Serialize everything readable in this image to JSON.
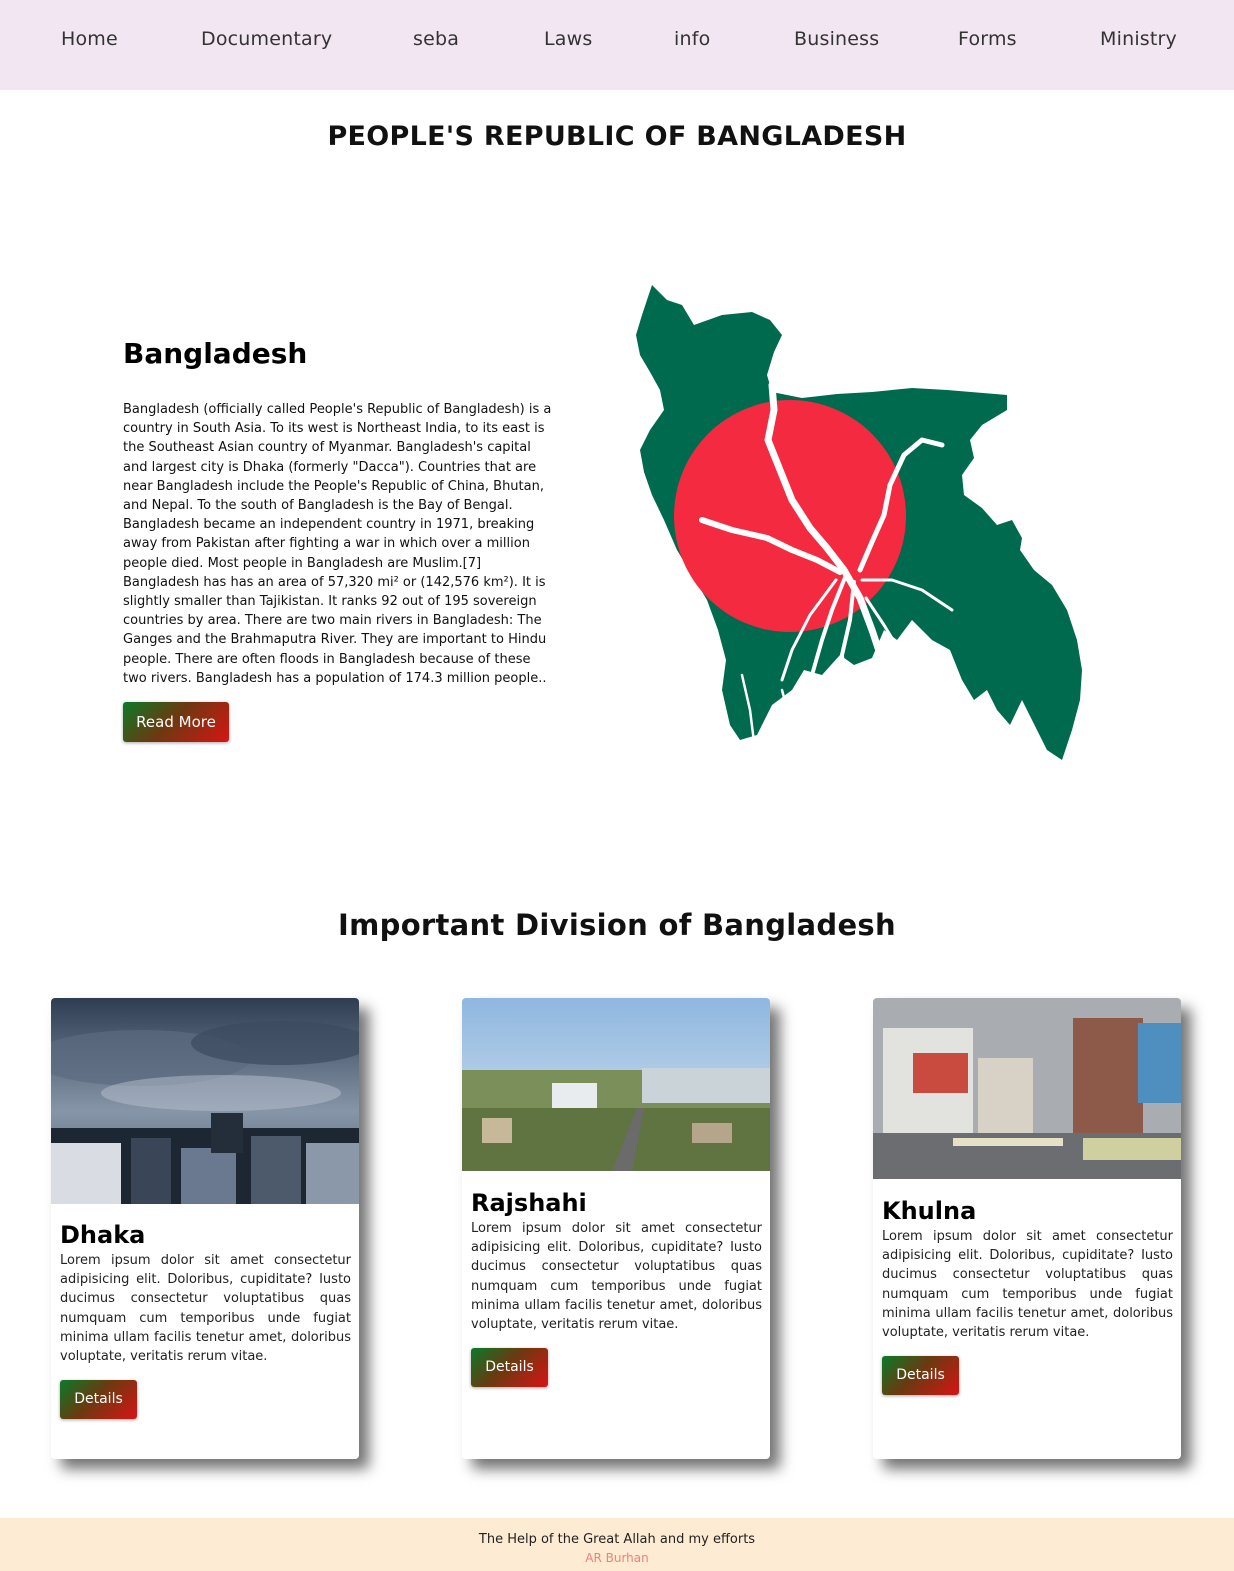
{
  "nav": {
    "items": [
      "Home",
      "Documentary",
      "seba",
      "Laws",
      "info",
      "Business",
      "Forms",
      "Ministry"
    ]
  },
  "page_title": "PEOPLE'S REPUBLIC OF BANGLADESH",
  "intro": {
    "heading": "Bangladesh",
    "text": "Bangladesh (officially called People's Republic of Bangladesh) is a country in South Asia. To its west is Northeast India, to its east is the Southeast Asian country of Myanmar. Bangladesh's capital and largest city is Dhaka (formerly \"Dacca\"). Countries that are near Bangladesh include the People's Republic of China, Bhutan, and Nepal. To the south of Bangladesh is the Bay of Bengal. Bangladesh became an independent country in 1971, breaking away from Pakistan after fighting a war in which over a million people died. Most people in Bangladesh are Muslim.[7] Bangladesh has has an area of 57,320 mi² or (142,576 km²). It is slightly smaller than Tajikistan. It ranks 92 out of 195 sovereign countries by area. There are two main rivers in Bangladesh: The Ganges and the Brahmaputra River. They are important to Hindu people. There are often floods in Bangladesh because of these two rivers. Bangladesh has a population of 174.3 million people..",
    "button_label": "Read More"
  },
  "divisions": {
    "title": "Important Division of Bangladesh",
    "cards": [
      {
        "name": "Dhaka",
        "text": "Lorem ipsum dolor sit amet consectetur adipisicing elit. Doloribus, cupiditate? Iusto ducimus consectetur voluptatibus quas numquam cum temporibus unde fugiat minima ullam facilis tenetur amet, doloribus voluptate, veritatis rerum vitae.",
        "button_label": "Details"
      },
      {
        "name": "Rajshahi",
        "text": "Lorem ipsum dolor sit amet consectetur adipisicing elit. Doloribus, cupiditate? Iusto ducimus consectetur voluptatibus quas numquam cum temporibus unde fugiat minima ullam facilis tenetur amet, doloribus voluptate, veritatis rerum vitae.",
        "button_label": "Details"
      },
      {
        "name": "Khulna",
        "text": "Lorem ipsum dolor sit amet consectetur adipisicing elit. Doloribus, cupiditate? Iusto ducimus consectetur voluptatibus quas numquam cum temporibus unde fugiat minima ullam facilis tenetur amet, doloribus voluptate, veritatis rerum vitae.",
        "button_label": "Details"
      }
    ]
  },
  "footer": {
    "line": "The Help of the Great Allah and my efforts",
    "author": "AR Burhan"
  },
  "colors": {
    "nav_bg": "#f2e6f2",
    "footer_bg": "#fdebd3",
    "flag_green": "#006a4e",
    "flag_red": "#f42a41",
    "author_text": "#f08080"
  }
}
